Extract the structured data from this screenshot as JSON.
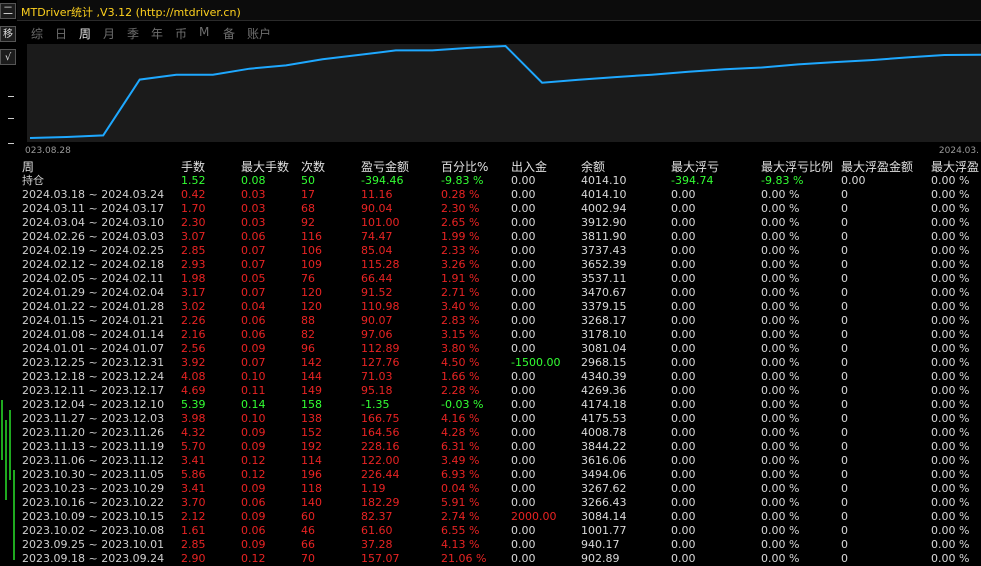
{
  "window": {
    "title": "MTDriver统计 ,V3.12 (http://mtdriver.cn)"
  },
  "left_strip": {
    "button_1": "二",
    "button_2": "移",
    "button_3": "√"
  },
  "tabs": [
    {
      "label": "综",
      "active": false
    },
    {
      "label": "日",
      "active": false
    },
    {
      "label": "周",
      "active": true
    },
    {
      "label": "月",
      "active": false
    },
    {
      "label": "季",
      "active": false
    },
    {
      "label": "年",
      "active": false
    },
    {
      "label": "币",
      "active": false
    },
    {
      "label": "M",
      "active": false
    },
    {
      "label": "备",
      "active": false
    },
    {
      "label": "账户",
      "active": false
    }
  ],
  "chart": {
    "x_start_label": "023.08.28",
    "x_end_label": "2024.03.",
    "line_color": "#1ea8ff",
    "background_color": "#1b1b1b"
  },
  "chart_data": {
    "type": "line",
    "series": [
      {
        "values": [
          902.89,
          940.17,
          1001.77,
          3084.14,
          3266.43,
          3267.62,
          3494.06,
          3616.06,
          3844.22,
          4008.78,
          4175.53,
          4174.18,
          4269.36,
          4340.39,
          2968.15,
          3081.04,
          3178.1,
          3268.17,
          3379.15,
          3470.67,
          3537.11,
          3652.39,
          3737.43,
          3811.9,
          3912.9,
          4002.94,
          4014.1
        ]
      }
    ]
  },
  "table": {
    "headers": {
      "period": "周",
      "lots": "手数",
      "max_lots": "最大手数",
      "count": "次数",
      "pnl": "盈亏金额",
      "pct": "百分比%",
      "io": "出入金",
      "balance": "余额",
      "max_float": "最大浮亏",
      "max_float_pct": "最大浮亏比例",
      "max_float_profit_amt": "最大浮盈金额",
      "max_float_profit": "最大浮盈"
    },
    "rows": [
      {
        "period": "持仓",
        "lots": "1.52",
        "max_lots": "0.08",
        "count": "50",
        "pnl": "-394.46",
        "pct": "-9.83 %",
        "io": "0.00",
        "balance": "4014.10",
        "max_float": "-394.74",
        "max_float_pct": "-9.83 %",
        "max_float_profit_amt": "0.00",
        "max_float_profit": "0.00 %",
        "color": "green"
      },
      {
        "period": "2024.03.18 ~ 2024.03.24",
        "lots": "0.42",
        "max_lots": "0.03",
        "count": "17",
        "pnl": "11.16",
        "pct": "0.28 %",
        "io": "0.00",
        "balance": "4014.10",
        "max_float": "0.00",
        "max_float_pct": "0.00 %",
        "max_float_profit_amt": "0",
        "max_float_profit": "0.00 %",
        "color": "red"
      },
      {
        "period": "2024.03.11 ~ 2024.03.17",
        "lots": "1.70",
        "max_lots": "0.03",
        "count": "68",
        "pnl": "90.04",
        "pct": "2.30 %",
        "io": "0.00",
        "balance": "4002.94",
        "max_float": "0.00",
        "max_float_pct": "0.00 %",
        "max_float_profit_amt": "0",
        "max_float_profit": "0.00 %",
        "color": "red"
      },
      {
        "period": "2024.03.04 ~ 2024.03.10",
        "lots": "2.30",
        "max_lots": "0.03",
        "count": "92",
        "pnl": "101.00",
        "pct": "2.65 %",
        "io": "0.00",
        "balance": "3912.90",
        "max_float": "0.00",
        "max_float_pct": "0.00 %",
        "max_float_profit_amt": "0",
        "max_float_profit": "0.00 %",
        "color": "red"
      },
      {
        "period": "2024.02.26 ~ 2024.03.03",
        "lots": "3.07",
        "max_lots": "0.06",
        "count": "116",
        "pnl": "74.47",
        "pct": "1.99 %",
        "io": "0.00",
        "balance": "3811.90",
        "max_float": "0.00",
        "max_float_pct": "0.00 %",
        "max_float_profit_amt": "0",
        "max_float_profit": "0.00 %",
        "color": "red"
      },
      {
        "period": "2024.02.19 ~ 2024.02.25",
        "lots": "2.85",
        "max_lots": "0.07",
        "count": "106",
        "pnl": "85.04",
        "pct": "2.33 %",
        "io": "0.00",
        "balance": "3737.43",
        "max_float": "0.00",
        "max_float_pct": "0.00 %",
        "max_float_profit_amt": "0",
        "max_float_profit": "0.00 %",
        "color": "red"
      },
      {
        "period": "2024.02.12 ~ 2024.02.18",
        "lots": "2.93",
        "max_lots": "0.07",
        "count": "109",
        "pnl": "115.28",
        "pct": "3.26 %",
        "io": "0.00",
        "balance": "3652.39",
        "max_float": "0.00",
        "max_float_pct": "0.00 %",
        "max_float_profit_amt": "0",
        "max_float_profit": "0.00 %",
        "color": "red"
      },
      {
        "period": "2024.02.05 ~ 2024.02.11",
        "lots": "1.98",
        "max_lots": "0.05",
        "count": "76",
        "pnl": "66.44",
        "pct": "1.91 %",
        "io": "0.00",
        "balance": "3537.11",
        "max_float": "0.00",
        "max_float_pct": "0.00 %",
        "max_float_profit_amt": "0",
        "max_float_profit": "0.00 %",
        "color": "red"
      },
      {
        "period": "2024.01.29 ~ 2024.02.04",
        "lots": "3.17",
        "max_lots": "0.07",
        "count": "120",
        "pnl": "91.52",
        "pct": "2.71 %",
        "io": "0.00",
        "balance": "3470.67",
        "max_float": "0.00",
        "max_float_pct": "0.00 %",
        "max_float_profit_amt": "0",
        "max_float_profit": "0.00 %",
        "color": "red"
      },
      {
        "period": "2024.01.22 ~ 2024.01.28",
        "lots": "3.02",
        "max_lots": "0.04",
        "count": "120",
        "pnl": "110.98",
        "pct": "3.40 %",
        "io": "0.00",
        "balance": "3379.15",
        "max_float": "0.00",
        "max_float_pct": "0.00 %",
        "max_float_profit_amt": "0",
        "max_float_profit": "0.00 %",
        "color": "red"
      },
      {
        "period": "2024.01.15 ~ 2024.01.21",
        "lots": "2.26",
        "max_lots": "0.06",
        "count": "88",
        "pnl": "90.07",
        "pct": "2.83 %",
        "io": "0.00",
        "balance": "3268.17",
        "max_float": "0.00",
        "max_float_pct": "0.00 %",
        "max_float_profit_amt": "0",
        "max_float_profit": "0.00 %",
        "color": "red"
      },
      {
        "period": "2024.01.08 ~ 2024.01.14",
        "lots": "2.16",
        "max_lots": "0.06",
        "count": "82",
        "pnl": "97.06",
        "pct": "3.15 %",
        "io": "0.00",
        "balance": "3178.10",
        "max_float": "0.00",
        "max_float_pct": "0.00 %",
        "max_float_profit_amt": "0",
        "max_float_profit": "0.00 %",
        "color": "red"
      },
      {
        "period": "2024.01.01 ~ 2024.01.07",
        "lots": "2.56",
        "max_lots": "0.09",
        "count": "96",
        "pnl": "112.89",
        "pct": "3.80 %",
        "io": "0.00",
        "balance": "3081.04",
        "max_float": "0.00",
        "max_float_pct": "0.00 %",
        "max_float_profit_amt": "0",
        "max_float_profit": "0.00 %",
        "color": "red"
      },
      {
        "period": "2023.12.25 ~ 2023.12.31",
        "lots": "3.92",
        "max_lots": "0.07",
        "count": "142",
        "pnl": "127.76",
        "pct": "4.50 %",
        "io": "-1500.00",
        "io_color": "green",
        "balance": "2968.15",
        "max_float": "0.00",
        "max_float_pct": "0.00 %",
        "max_float_profit_amt": "0",
        "max_float_profit": "0.00 %",
        "color": "red"
      },
      {
        "period": "2023.12.18 ~ 2023.12.24",
        "lots": "4.08",
        "max_lots": "0.10",
        "count": "144",
        "pnl": "71.03",
        "pct": "1.66 %",
        "io": "0.00",
        "balance": "4340.39",
        "max_float": "0.00",
        "max_float_pct": "0.00 %",
        "max_float_profit_amt": "0",
        "max_float_profit": "0.00 %",
        "color": "red"
      },
      {
        "period": "2023.12.11 ~ 2023.12.17",
        "lots": "4.69",
        "max_lots": "0.11",
        "count": "149",
        "pnl": "95.18",
        "pct": "2.28 %",
        "io": "0.00",
        "balance": "4269.36",
        "max_float": "0.00",
        "max_float_pct": "0.00 %",
        "max_float_profit_amt": "0",
        "max_float_profit": "0.00 %",
        "color": "red"
      },
      {
        "period": "2023.12.04 ~ 2023.12.10",
        "lots": "5.39",
        "max_lots": "0.14",
        "count": "158",
        "pnl": "-1.35",
        "pct": "-0.03 %",
        "io": "0.00",
        "balance": "4174.18",
        "max_float": "0.00",
        "max_float_pct": "0.00 %",
        "max_float_profit_amt": "0",
        "max_float_profit": "0.00 %",
        "color": "green"
      },
      {
        "period": "2023.11.27 ~ 2023.12.03",
        "lots": "3.98",
        "max_lots": "0.10",
        "count": "138",
        "pnl": "166.75",
        "pct": "4.16 %",
        "io": "0.00",
        "balance": "4175.53",
        "max_float": "0.00",
        "max_float_pct": "0.00 %",
        "max_float_profit_amt": "0",
        "max_float_profit": "0.00 %",
        "color": "red"
      },
      {
        "period": "2023.11.20 ~ 2023.11.26",
        "lots": "4.32",
        "max_lots": "0.09",
        "count": "152",
        "pnl": "164.56",
        "pct": "4.28 %",
        "io": "0.00",
        "balance": "4008.78",
        "max_float": "0.00",
        "max_float_pct": "0.00 %",
        "max_float_profit_amt": "0",
        "max_float_profit": "0.00 %",
        "color": "red"
      },
      {
        "period": "2023.11.13 ~ 2023.11.19",
        "lots": "5.70",
        "max_lots": "0.09",
        "count": "192",
        "pnl": "228.16",
        "pct": "6.31 %",
        "io": "0.00",
        "balance": "3844.22",
        "max_float": "0.00",
        "max_float_pct": "0.00 %",
        "max_float_profit_amt": "0",
        "max_float_profit": "0.00 %",
        "color": "red"
      },
      {
        "period": "2023.11.06 ~ 2023.11.12",
        "lots": "3.41",
        "max_lots": "0.12",
        "count": "114",
        "pnl": "122.00",
        "pct": "3.49 %",
        "io": "0.00",
        "balance": "3616.06",
        "max_float": "0.00",
        "max_float_pct": "0.00 %",
        "max_float_profit_amt": "0",
        "max_float_profit": "0.00 %",
        "color": "red"
      },
      {
        "period": "2023.10.30 ~ 2023.11.05",
        "lots": "5.86",
        "max_lots": "0.12",
        "count": "196",
        "pnl": "226.44",
        "pct": "6.93 %",
        "io": "0.00",
        "balance": "3494.06",
        "max_float": "0.00",
        "max_float_pct": "0.00 %",
        "max_float_profit_amt": "0",
        "max_float_profit": "0.00 %",
        "color": "red"
      },
      {
        "period": "2023.10.23 ~ 2023.10.29",
        "lots": "3.41",
        "max_lots": "0.09",
        "count": "118",
        "pnl": "1.19",
        "pct": "0.04 %",
        "io": "0.00",
        "balance": "3267.62",
        "max_float": "0.00",
        "max_float_pct": "0.00 %",
        "max_float_profit_amt": "0",
        "max_float_profit": "0.00 %",
        "color": "red"
      },
      {
        "period": "2023.10.16 ~ 2023.10.22",
        "lots": "3.70",
        "max_lots": "0.06",
        "count": "140",
        "pnl": "182.29",
        "pct": "5.91 %",
        "io": "0.00",
        "balance": "3266.43",
        "max_float": "0.00",
        "max_float_pct": "0.00 %",
        "max_float_profit_amt": "0",
        "max_float_profit": "0.00 %",
        "color": "red"
      },
      {
        "period": "2023.10.09 ~ 2023.10.15",
        "lots": "2.12",
        "max_lots": "0.09",
        "count": "60",
        "pnl": "82.37",
        "pct": "2.74 %",
        "io": "2000.00",
        "io_color": "red",
        "balance": "3084.14",
        "max_float": "0.00",
        "max_float_pct": "0.00 %",
        "max_float_profit_amt": "0",
        "max_float_profit": "0.00 %",
        "color": "red"
      },
      {
        "period": "2023.10.02 ~ 2023.10.08",
        "lots": "1.61",
        "max_lots": "0.06",
        "count": "46",
        "pnl": "61.60",
        "pct": "6.55 %",
        "io": "0.00",
        "balance": "1001.77",
        "max_float": "0.00",
        "max_float_pct": "0.00 %",
        "max_float_profit_amt": "0",
        "max_float_profit": "0.00 %",
        "color": "red"
      },
      {
        "period": "2023.09.25 ~ 2023.10.01",
        "lots": "2.85",
        "max_lots": "0.09",
        "count": "66",
        "pnl": "37.28",
        "pct": "4.13 %",
        "io": "0.00",
        "balance": "940.17",
        "max_float": "0.00",
        "max_float_pct": "0.00 %",
        "max_float_profit_amt": "0",
        "max_float_profit": "0.00 %",
        "color": "red"
      },
      {
        "period": "2023.09.18 ~ 2023.09.24",
        "lots": "2.90",
        "max_lots": "0.12",
        "count": "70",
        "pnl": "157.07",
        "pct": "21.06 %",
        "io": "0.00",
        "balance": "902.89",
        "max_float": "0.00",
        "max_float_pct": "0.00 %",
        "max_float_profit_amt": "0",
        "max_float_profit": "0.00 %",
        "color": "red"
      }
    ]
  }
}
